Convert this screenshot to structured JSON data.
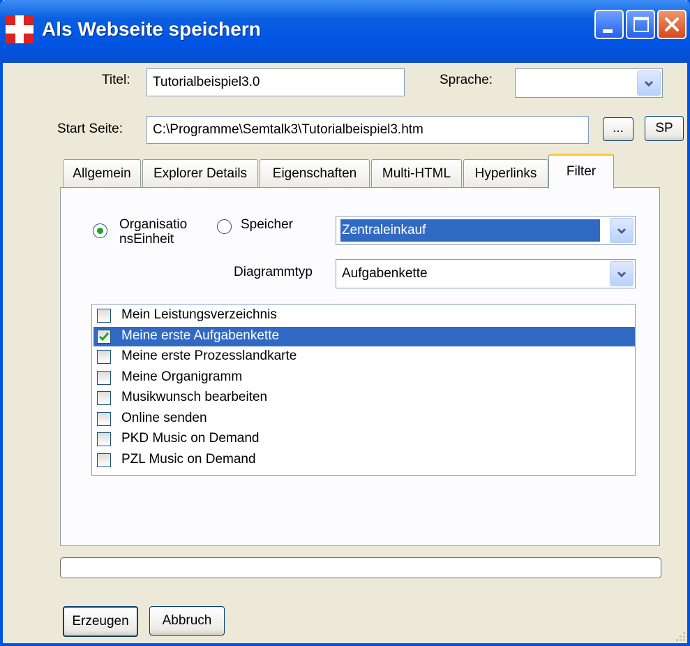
{
  "window": {
    "title": "Als Webseite speichern"
  },
  "form": {
    "titel_label": "Titel:",
    "titel_value": "Tutorialbeispiel3.0",
    "sprache_label": "Sprache:",
    "sprache_value": "",
    "start_label": "Start Seite:",
    "start_value": "C:\\Programme\\Semtalk3\\Tutorialbeispiel3.htm",
    "browse_label": "...",
    "sp_label": "SP"
  },
  "tabs": [
    "Allgemein",
    "Explorer Details",
    "Eigenschaften",
    "Multi-HTML",
    "Hyperlinks",
    "Filter"
  ],
  "active_tab": "Filter",
  "filter": {
    "radio1_label_line1": "Organisatio",
    "radio1_label_line2": "nsEinheit",
    "radio2_label": "Speicher",
    "unit_value": "Zentraleinkauf",
    "diagrammtyp_label": "Diagrammtyp",
    "diagrammtyp_value": "Aufgabenkette",
    "items": [
      {
        "label": "Mein Leistungsverzeichnis",
        "checked": false
      },
      {
        "label": "Meine erste Aufgabenkette",
        "checked": true
      },
      {
        "label": "Meine erste Prozesslandkarte",
        "checked": false
      },
      {
        "label": "Meine Organigramm",
        "checked": false
      },
      {
        "label": "Musikwunsch bearbeiten",
        "checked": false
      },
      {
        "label": "Online senden",
        "checked": false
      },
      {
        "label": "PKD Music on Demand",
        "checked": false
      },
      {
        "label": "PZL Music on Demand",
        "checked": false
      }
    ]
  },
  "buttons": {
    "create": "Erzeugen",
    "cancel": "Abbruch"
  },
  "colors": {
    "titlebar": "#0054e3",
    "selection": "#316ac5",
    "dialog": "#ece9d8",
    "tab_accent": "#ffc83c"
  }
}
